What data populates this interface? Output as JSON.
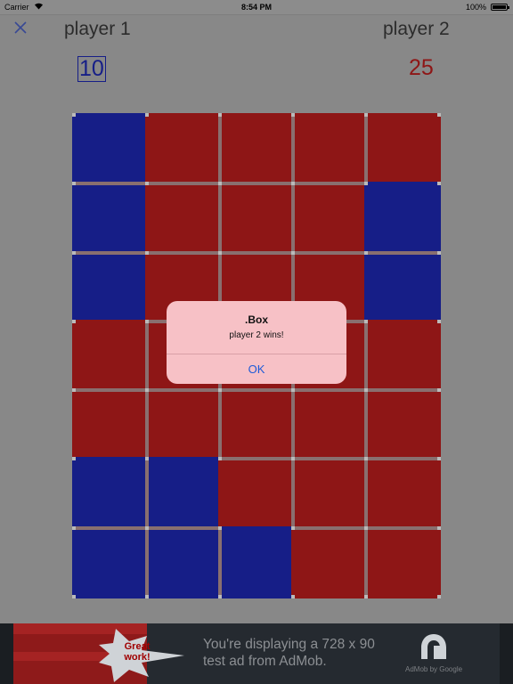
{
  "status_bar": {
    "carrier": "Carrier",
    "time": "8:54 PM",
    "battery": "100%"
  },
  "header": {
    "close_icon": "×",
    "player1": {
      "name": "player 1",
      "score": "10"
    },
    "player2": {
      "name": "player 2",
      "score": "25"
    }
  },
  "board": {
    "rows": 7,
    "cols": 5,
    "colors": {
      "blue": "#000a8a",
      "red": "#930000",
      "dot": "#c8c8c8",
      "unclaimed_line": "#8d6d6d"
    },
    "cells": [
      [
        "blue",
        "red",
        "red",
        "red",
        "red"
      ],
      [
        "blue",
        "red",
        "red",
        "red",
        "blue"
      ],
      [
        "blue",
        "red",
        "red",
        "red",
        "blue"
      ],
      [
        "red",
        "red",
        "red",
        "red",
        "red"
      ],
      [
        "red",
        "red",
        "red",
        "red",
        "red"
      ],
      [
        "blue",
        "blue",
        "red",
        "red",
        "red"
      ],
      [
        "blue",
        "blue",
        "blue",
        "red",
        "red"
      ]
    ]
  },
  "alert": {
    "title": ".Box",
    "message": "player 2 wins!",
    "button": "OK"
  },
  "ad": {
    "badge": "Great work!",
    "text": "You're displaying a 728 x 90 test ad from AdMob.",
    "brand": "AdMob by Google"
  }
}
